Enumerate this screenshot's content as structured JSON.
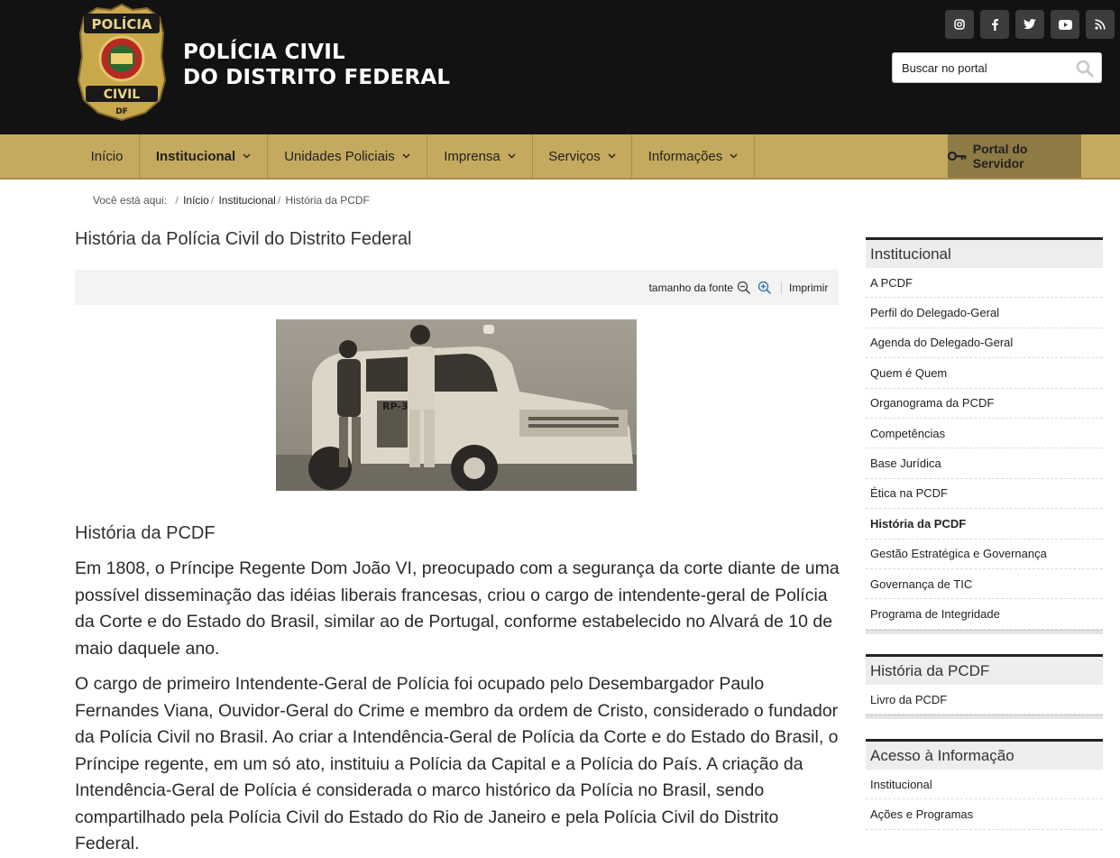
{
  "header": {
    "badge_text_top": "POLÍCIA",
    "badge_text_bottom": "CIVIL",
    "badge_text_df": "DF",
    "brand_line1": "POLÍCIA CIVIL",
    "brand_line2": "DO DISTRITO FEDERAL",
    "social_icons": [
      "instagram-icon",
      "facebook-icon",
      "twitter-icon",
      "youtube-icon",
      "rss-icon"
    ],
    "search_placeholder": "Buscar no portal"
  },
  "nav": {
    "items": [
      {
        "label": "Início",
        "has_dropdown": false
      },
      {
        "label": "Institucional",
        "has_dropdown": true,
        "active": true
      },
      {
        "label": "Unidades Policiais",
        "has_dropdown": true
      },
      {
        "label": "Imprensa",
        "has_dropdown": true
      },
      {
        "label": "Serviços",
        "has_dropdown": true
      },
      {
        "label": "Informações",
        "has_dropdown": true
      }
    ],
    "portal_label": "Portal do Servidor"
  },
  "breadcrumb": {
    "prefix": "Você está aqui:",
    "items": [
      "Início",
      "Institucional",
      "História da PCDF"
    ]
  },
  "main": {
    "title": "História da Polícia Civil do Distrito Federal",
    "font_size_label": "tamanho da fonte",
    "print_label": "Imprimir",
    "photo_plate_text": "RP-38",
    "section_title": "História da PCDF",
    "paragraph1": "Em 1808, o Príncipe Regente Dom João VI, preocupado com a segurança da corte diante de uma possível disseminação das idéias liberais francesas, criou o cargo de intendente-geral de Polícia da Corte e do Estado do Brasil, similar ao de Portugal, conforme estabelecido no Alvará de 10 de maio daquele ano.",
    "paragraph2": "O cargo de primeiro Intendente-Geral de Polícia foi ocupado pelo Desembargador Paulo Fernandes Viana, Ouvidor-Geral do Crime e membro da ordem de Cristo, considerado o fundador da Polícia Civil no Brasil. Ao criar a Intendência-Geral de Polícia da Corte e do Estado do Brasil, o Príncipe regente, em um só ato, instituiu a Polícia da Capital e a Polícia do País. A criação da Intendência-Geral de Polícia é considerada o marco histórico da Polícia no Brasil, sendo compartilhado pela Polícia Civil do Estado do Rio de Janeiro e pela Polícia Civil do Distrito Federal."
  },
  "sidebar": {
    "groups": [
      {
        "title": "Institucional",
        "items": [
          "A PCDF",
          "Perfil do Delegado-Geral",
          "Agenda do Delegado-Geral",
          "Quem é Quem",
          "Organograma da PCDF",
          "Competências",
          "Base Jurídica",
          "Ética na PCDF",
          "História da PCDF",
          "Gestão Estratégica e Governança",
          "Governança de TIC",
          "Programa de Integridade"
        ],
        "active_index": 8
      },
      {
        "title": "História da PCDF",
        "items": [
          "Livro da PCDF"
        ]
      },
      {
        "title": "Acesso à Informação",
        "items": [
          "Institucional",
          "Ações e Programas"
        ]
      }
    ]
  },
  "colors": {
    "header_bg": "#121212",
    "nav_bg": "#c4a95e",
    "portal_bg": "#8e7a44",
    "badge_gold": "#c9a84c"
  }
}
